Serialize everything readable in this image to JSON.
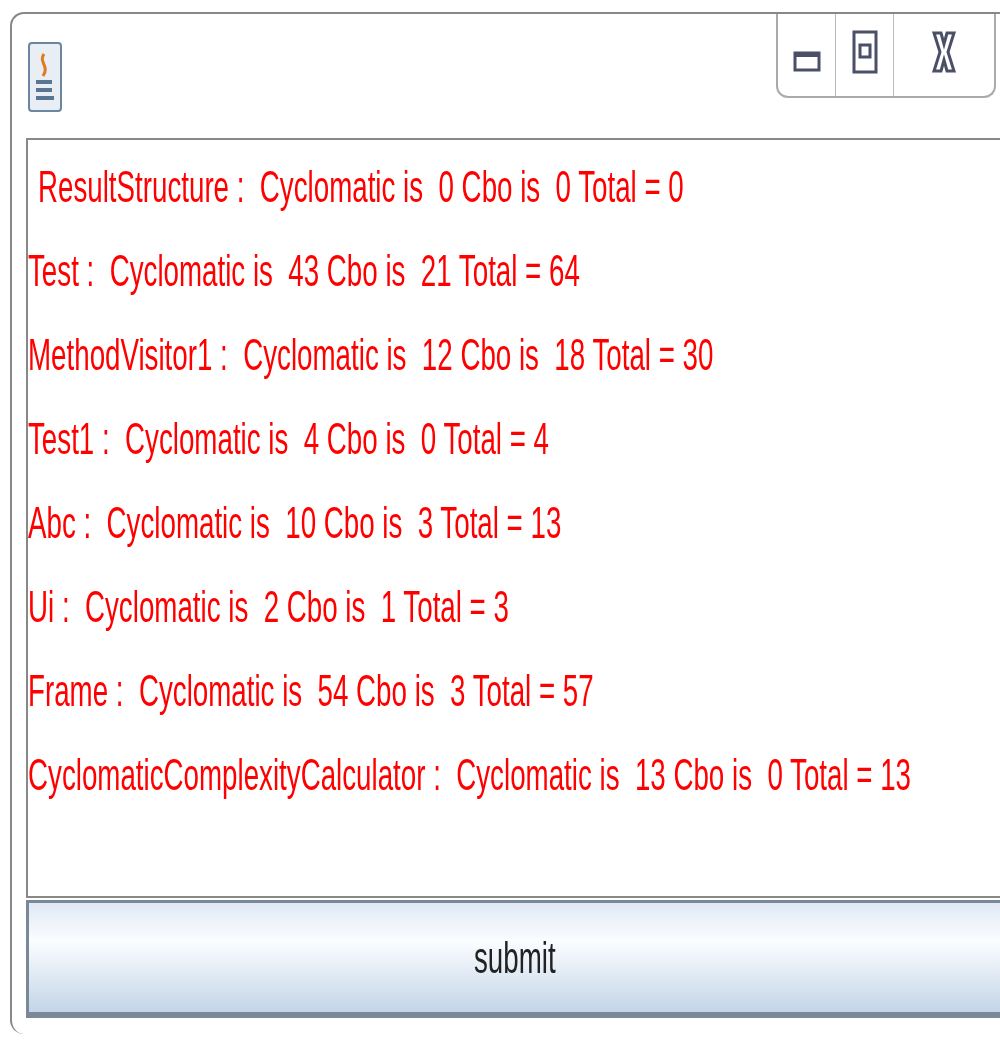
{
  "results": [
    "ResultStructure :  Cyclomatic is  0 Cbo is  0 Total = 0",
    "Test :  Cyclomatic is  43 Cbo is  21 Total = 64",
    "MethodVisitor1 :  Cyclomatic is  12 Cbo is  18 Total = 30",
    "Test1 :  Cyclomatic is  4 Cbo is  0 Total = 4",
    "Abc :  Cyclomatic is  10 Cbo is  3 Total = 13",
    "Ui :  Cyclomatic is  2 Cbo is  1 Total = 3",
    "Frame :  Cyclomatic is  54 Cbo is  3 Total = 57",
    "CyclomaticComplexityCalculator :  Cyclomatic is  13 Cbo is  0 Total = 13"
  ],
  "submit_button": {
    "label": "submit"
  }
}
